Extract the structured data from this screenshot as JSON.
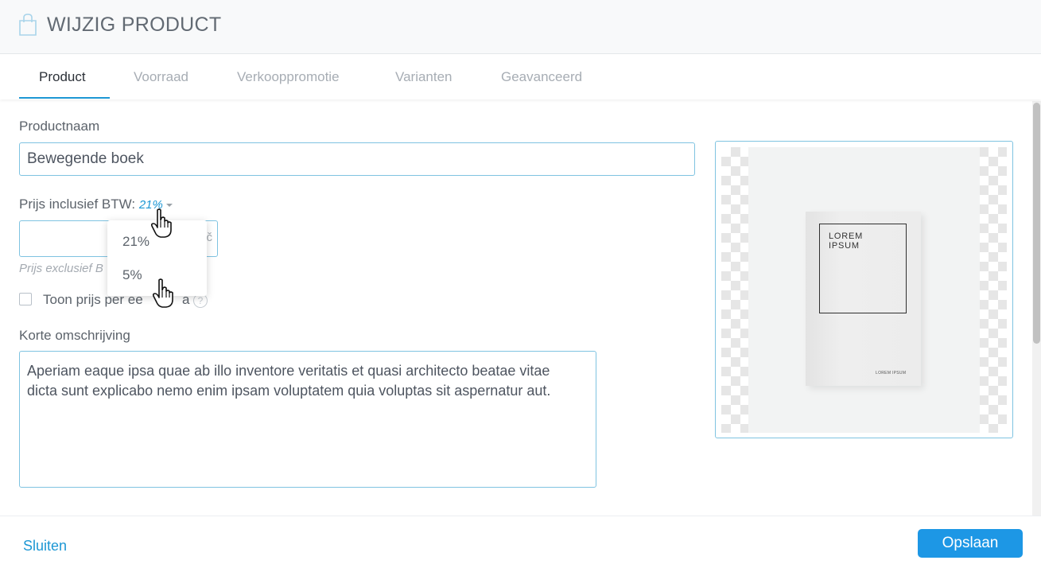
{
  "header": {
    "title": "WIJZIG PRODUCT",
    "icon": "shopping-bag-icon"
  },
  "tabs": [
    {
      "label": "Product",
      "active": true
    },
    {
      "label": "Voorraad",
      "active": false
    },
    {
      "label": "Verkooppromotie",
      "active": false
    },
    {
      "label": "Varianten",
      "active": false
    },
    {
      "label": "Geavanceerd",
      "active": false
    }
  ],
  "form": {
    "product_name_label": "Productnaam",
    "product_name_value": "Bewegende boek",
    "price_label": "Prijs inclusief BTW:",
    "vat_selected": "21%",
    "price_value": "",
    "currency_symbol": "č",
    "price_excl_hint": "Prijs exclusief B",
    "show_unit_price_label": "Toon prijs per ee",
    "show_unit_price_label_tail": "a",
    "help_symbol": "?",
    "short_description_label": "Korte omschrijving",
    "short_description_value": "Aperiam eaque ipsa quae ab illo inventore veritatis et quasi architecto beatae vitae dicta sunt explicabo nemo enim ipsam voluptatem quia voluptas sit aspernatur aut."
  },
  "vat_dropdown": {
    "options": [
      "21%",
      "5%"
    ]
  },
  "product_image": {
    "book_title": "LOREM\nIPSUM",
    "book_footer": "LOREM IPSUM"
  },
  "footer": {
    "close_label": "Sluiten",
    "save_label": "Opslaan"
  },
  "colors": {
    "accent": "#1d97d4",
    "button": "#1d97e5",
    "border": "#7fc3e1"
  }
}
